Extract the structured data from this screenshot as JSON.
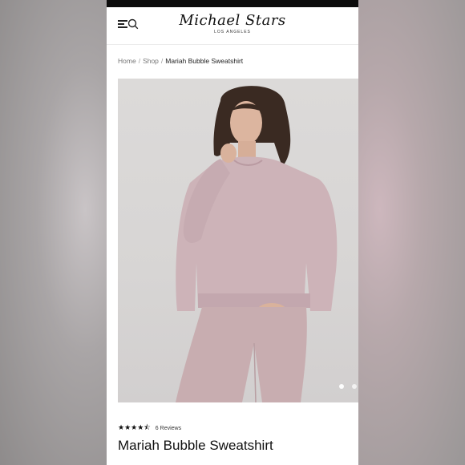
{
  "brand": {
    "name": "Michael Stars",
    "tagline": "LOS ANGELES"
  },
  "breadcrumb": {
    "items": [
      "Home",
      "Shop",
      "Mariah Bubble Sweatshirt"
    ],
    "separator": "/"
  },
  "product": {
    "title": "Mariah Bubble Sweatshirt",
    "rating_stars": "★★★★⯪",
    "rating_value": 4.5,
    "reviews_label": "6 Reviews",
    "image_alt": "Model wearing pink sweatshirt and joggers"
  },
  "carousel": {
    "slide_count": 2,
    "active_index": 0
  },
  "icons": {
    "menu": "hamburger-icon",
    "search": "search-icon"
  },
  "colors": {
    "status_bar": "#0c0c0c",
    "text": "#111111",
    "garment": "#cdb3b8"
  }
}
